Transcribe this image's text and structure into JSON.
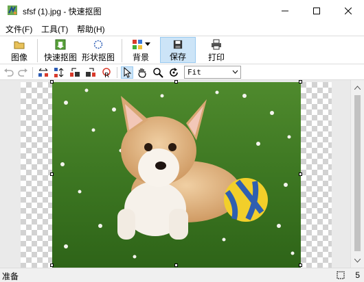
{
  "window": {
    "title": "sfsf (1).jpg - 快速抠图",
    "app_icon": "app-logo-icon",
    "controls": [
      "minimize-icon",
      "maximize-icon",
      "close-icon"
    ]
  },
  "menu": {
    "file": "文件(F)",
    "tools": "工具(T)",
    "help": "帮助(H)"
  },
  "toolbar": {
    "image": "图像",
    "quick_cutout": "快速抠图",
    "shape_cutout": "形状抠图",
    "background": "背景",
    "save": "保存",
    "print": "打印",
    "active": "save"
  },
  "toolbar2": {
    "icons": [
      "undo-icon",
      "redo-icon",
      "flip-horizontal-icon",
      "flip-vertical-icon",
      "rotate-left-icon",
      "rotate-right-icon",
      "reset-icon",
      "pointer-icon",
      "hand-pan-icon",
      "zoom-icon",
      "refresh-icon"
    ],
    "active_tool": "pointer-icon",
    "zoom_value": "Fit"
  },
  "canvas": {
    "content": "photo-corgi-puppy-on-grass-with-ball"
  },
  "status": {
    "text": "准备",
    "right": "5"
  },
  "colors": {
    "selection": "#cce4f7",
    "selection_border": "#99c9ef",
    "grass": "#3f7a22",
    "scroll_thumb": "#c2c2c2"
  }
}
